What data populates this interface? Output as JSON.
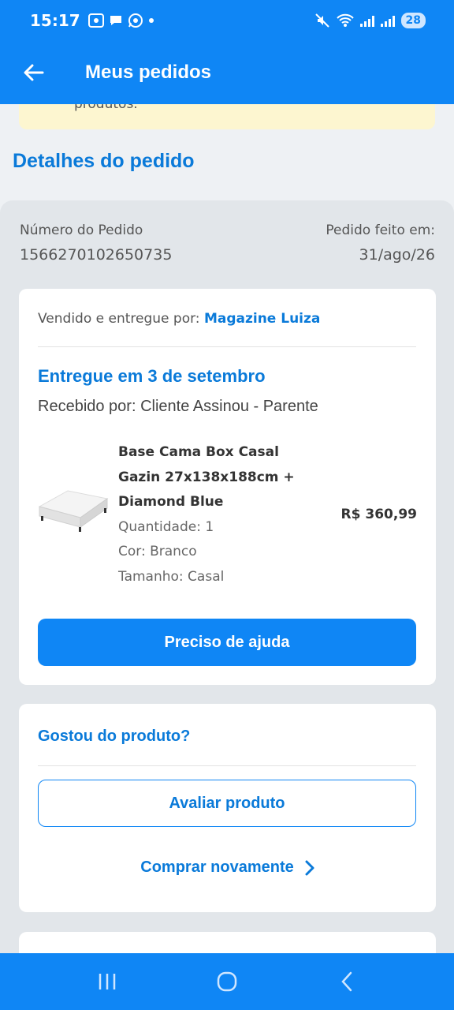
{
  "status_bar": {
    "time": "15:17",
    "battery": "28"
  },
  "app_bar": {
    "title": "Meus pedidos"
  },
  "notice": {
    "text": "produtos."
  },
  "page": {
    "section_title": "Detalhes do pedido"
  },
  "order": {
    "number_label": "Número do Pedido",
    "number_value": "1566270102650735",
    "date_label": "Pedido feito em:",
    "date_value": "31/ago/26"
  },
  "delivery_card": {
    "seller_prefix": "Vendido e entregue por:",
    "seller_name": "Magazine Luiza",
    "status": "Entregue em 3 de setembro",
    "received_by": "Recebido por: Cliente Assinou - Parente",
    "product": {
      "name_line1": "Base Cama Box Casal",
      "name_line2": "Gazin 27x138x188cm +",
      "name_line3": "Diamond Blue",
      "quantity": "Quantidade: 1",
      "color": "Cor: Branco",
      "size": "Tamanho: Casal",
      "price": "R$ 360,99"
    },
    "help_button": "Preciso de ajuda"
  },
  "review_card": {
    "question": "Gostou do produto?",
    "rate_button": "Avaliar produto",
    "buy_again": "Comprar novamente"
  },
  "colors": {
    "primary": "#0f86f5",
    "link": "#0a7ad9",
    "notice_bg": "#fdf6d0"
  }
}
